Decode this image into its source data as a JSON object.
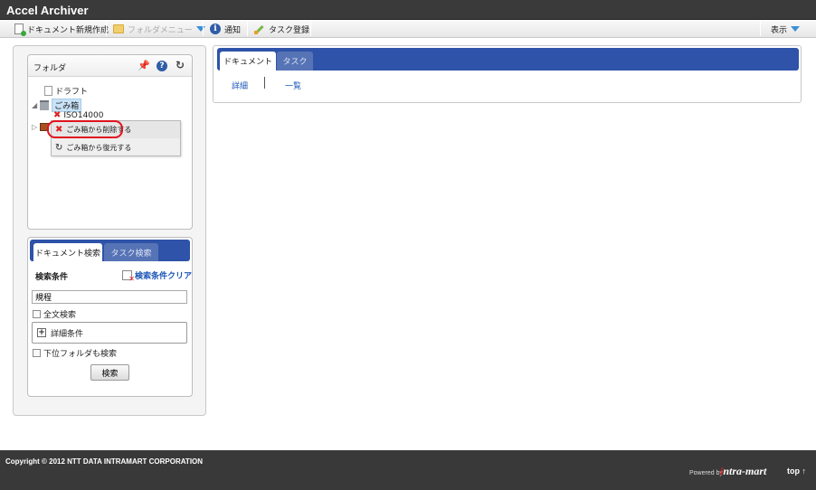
{
  "app": {
    "title": "Accel Archiver"
  },
  "toolbar": {
    "new_document": "ドキュメント新規作成",
    "folder_menu": "フォルダメニュー",
    "notification": "通知",
    "task_register": "タスク登録",
    "display": "表示"
  },
  "folder_panel": {
    "title": "フォルダ",
    "tree": {
      "draft": "ドラフト",
      "trash": "ごみ箱",
      "trash_child": "ISO14000"
    },
    "context_menu": {
      "delete_from_trash": "ごみ箱から削除する",
      "restore_from_trash": "ごみ箱から復元する"
    }
  },
  "search_panel": {
    "tabs": [
      "ドキュメント検索",
      "タスク検索"
    ],
    "condition_label": "検索条件",
    "clear_label": "検索条件クリア",
    "keyword_value": "規程",
    "fulltext_label": "全文検索",
    "fulltext_checked": false,
    "detail_label": "詳細条件",
    "subfolder_label": "下位フォルダも検索",
    "subfolder_checked": false,
    "search_button": "検索"
  },
  "main": {
    "tabs": [
      "ドキュメント",
      "タスク"
    ],
    "links": {
      "detail": "詳細",
      "list": "一覧"
    }
  },
  "footer": {
    "copyright": "Copyright © 2012 NTT DATA INTRAMART CORPORATION",
    "powered_by": "Powered by",
    "brand": "intra-mart",
    "top_link": "top ↑"
  },
  "colors": {
    "title_bar": "#3a3a3a",
    "tab_bar": "#2e53a8",
    "link": "#1a55b5",
    "highlight_ring": "#e0141e",
    "footer": "#393939"
  }
}
